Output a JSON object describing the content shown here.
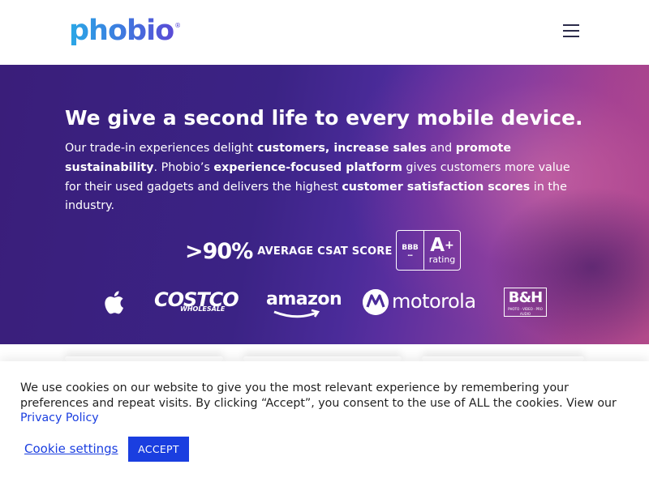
{
  "header": {
    "logo_text": "phobio",
    "logo_mark": "®",
    "menu_icon": "hamburger-menu-icon"
  },
  "hero": {
    "title_pre": "We give a ",
    "title_bold": "second life",
    "title_post": " to every mobile device.",
    "desc": {
      "p1": "Our trade-in experiences delight ",
      "b1": "customers, increase sales",
      "p2": " and ",
      "b2": "promote sustainability",
      "p3": ". Phobio’s ",
      "b3": "experience-focused platform",
      "p4": " gives customers more value for their used gadgets and delivers the highest ",
      "b4": "customer satisfaction scores",
      "p5": " in the industry."
    },
    "stat_value": ">90%",
    "stat_label": "AVERAGE CSAT SCORE",
    "bbb": {
      "mark": "BBB",
      "grade": "A",
      "grade_plus": "+",
      "rating_word": "rating"
    },
    "brands": {
      "apple_icon": "apple-logo-icon",
      "costco": "COSTCO",
      "costco_sub": "WHOLESALE",
      "amazon": "amazon",
      "motorola": "motorola",
      "motorola_icon": "motorola-logo-icon",
      "bh": "B&H",
      "bh_sub": "PHOTO · VIDEO · PRO AUDIO"
    }
  },
  "cookie": {
    "text": "We use cookies on our website to give you the most relevant experience by remembering your preferences and repeat visits. By clicking “Accept”, you consent to the use of ALL the cookies. View our",
    "privacy_link": "Privacy Policy",
    "settings_link": "Cookie settings",
    "accept_label": "ACCEPT"
  },
  "colors": {
    "brand_blue": "#1a3ee0",
    "hero_purple": "#3b2385",
    "logo_gradient_start": "#2aa8e6",
    "logo_gradient_end": "#5a4bd6"
  }
}
